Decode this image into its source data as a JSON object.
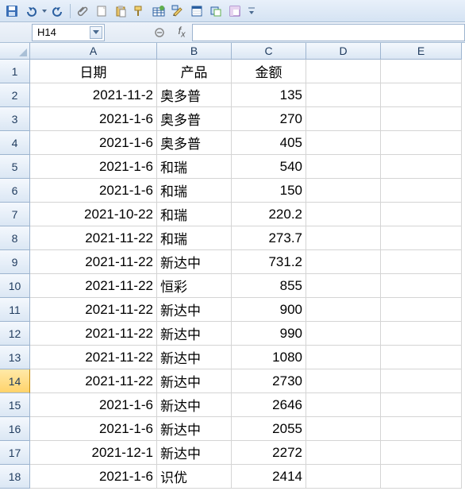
{
  "toolbar": {
    "icons": [
      "save-icon",
      "undo-icon",
      "redo-icon",
      "attach-icon",
      "new-icon",
      "paste-icon",
      "format-icon",
      "insert-table-icon",
      "chart-icon",
      "sheet-icon",
      "object-icon",
      "pivot-icon"
    ]
  },
  "namebox": {
    "ref": "H14"
  },
  "formula_bar": {
    "value": ""
  },
  "columns": [
    "A",
    "B",
    "C",
    "D",
    "E"
  ],
  "active_row": 14,
  "headers": {
    "A": "日期",
    "B": "产品",
    "C": "金额"
  },
  "rows": [
    {
      "n": 1,
      "A": "日期",
      "B": "奥多普",
      "C": "金额",
      "header": true
    },
    {
      "n": 2,
      "A": "2021-11-2",
      "B": "奥多普",
      "C": "135"
    },
    {
      "n": 3,
      "A": "2021-1-6",
      "B": "奥多普",
      "C": "270"
    },
    {
      "n": 4,
      "A": "2021-1-6",
      "B": "奥多普",
      "C": "405"
    },
    {
      "n": 5,
      "A": "2021-1-6",
      "B": "和瑞",
      "C": "540"
    },
    {
      "n": 6,
      "A": "2021-1-6",
      "B": "和瑞",
      "C": "150"
    },
    {
      "n": 7,
      "A": "2021-10-22",
      "B": "和瑞",
      "C": "220.2"
    },
    {
      "n": 8,
      "A": "2021-11-22",
      "B": "和瑞",
      "C": "273.7"
    },
    {
      "n": 9,
      "A": "2021-11-22",
      "B": "新达中",
      "C": "731.2"
    },
    {
      "n": 10,
      "A": "2021-11-22",
      "B": "恒彩",
      "C": "855"
    },
    {
      "n": 11,
      "A": "2021-11-22",
      "B": "新达中",
      "C": "900"
    },
    {
      "n": 12,
      "A": "2021-11-22",
      "B": "新达中",
      "C": "990"
    },
    {
      "n": 13,
      "A": "2021-11-22",
      "B": "新达中",
      "C": "1080"
    },
    {
      "n": 14,
      "A": "2021-11-22",
      "B": "新达中",
      "C": "2730"
    },
    {
      "n": 15,
      "A": "2021-1-6",
      "B": "新达中",
      "C": "2646"
    },
    {
      "n": 16,
      "A": "2021-1-6",
      "B": "新达中",
      "C": "2055"
    },
    {
      "n": 17,
      "A": "2021-12-1",
      "B": "新达中",
      "C": "2272"
    },
    {
      "n": 18,
      "A": "2021-1-6",
      "B": "识优",
      "C": "2414"
    }
  ]
}
